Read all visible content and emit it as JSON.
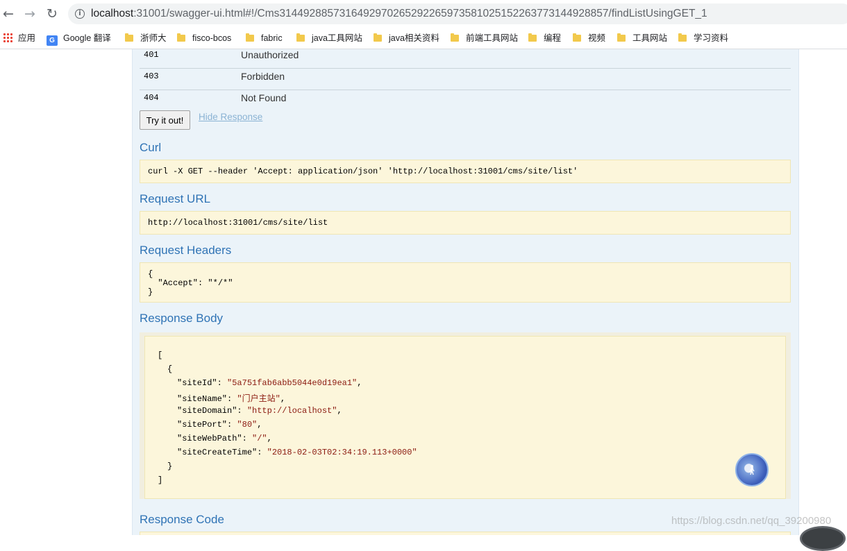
{
  "browser": {
    "back_icon": "←",
    "forward_icon": "→",
    "reload_icon": "↻",
    "info_icon": "i",
    "url_host": "localhost",
    "url_rest": ":31001/swagger-ui.html#!/Cms314492885731649297026529226597358102515226377314492885​7/findListUsingGET_1"
  },
  "bookmarks": [
    {
      "label": "应用",
      "icon": "apps-icon"
    },
    {
      "label": "Google 翻译",
      "icon": "google-translate-icon"
    },
    {
      "label": "浙师大",
      "icon": "folder-icon"
    },
    {
      "label": "fisco-bcos",
      "icon": "folder-icon"
    },
    {
      "label": "fabric",
      "icon": "folder-icon"
    },
    {
      "label": "java工具网站",
      "icon": "folder-icon"
    },
    {
      "label": "java相关资料",
      "icon": "folder-icon"
    },
    {
      "label": "前端工具网站",
      "icon": "folder-icon"
    },
    {
      "label": "编程",
      "icon": "folder-icon"
    },
    {
      "label": "视频",
      "icon": "folder-icon"
    },
    {
      "label": "工具网站",
      "icon": "folder-icon"
    },
    {
      "label": "学习资料",
      "icon": "folder-icon"
    }
  ],
  "status_rows": [
    {
      "code": "401",
      "reason": "Unauthorized"
    },
    {
      "code": "403",
      "reason": "Forbidden"
    },
    {
      "code": "404",
      "reason": "Not Found"
    }
  ],
  "actions": {
    "try_label": "Try it out!",
    "hide_label": "Hide Response"
  },
  "sections": {
    "curl_title": "Curl",
    "curl_value": "curl -X GET --header 'Accept: application/json' 'http://localhost:31001/cms/site/list'",
    "request_url_title": "Request URL",
    "request_url_value": "http://localhost:31001/cms/site/list",
    "request_headers_title": "Request Headers",
    "headers_lines": [
      "{",
      "  \"Accept\": \"*/*\"",
      "}"
    ],
    "response_body_title": "Response Body",
    "response_code_title": "Response Code"
  },
  "response_body": {
    "open_bracket": "[",
    "open_brace": "{",
    "fields": [
      {
        "key": "\"siteId\"",
        "value": "\"5a751fab6abb5044e0d19ea1\""
      },
      {
        "key": "\"siteName\"",
        "value": "\"门户主站\""
      },
      {
        "key": "\"siteDomain\"",
        "value": "\"http://localhost\""
      },
      {
        "key": "\"sitePort\"",
        "value": "\"80\""
      },
      {
        "key": "\"siteWebPath\"",
        "value": "\"/\""
      },
      {
        "key": "\"siteCreateTime\"",
        "value": "\"2018-02-03T02:34:19.113+0000\""
      }
    ],
    "close_brace": "}",
    "close_bracket": "]"
  },
  "watermark": "https://blog.csdn.net/qq_39200980",
  "colors": {
    "section_title": "#2f73b5",
    "code_block_bg": "#fcf6db",
    "panel_bg": "#ebf3f9",
    "json_string": "#8b1a10"
  }
}
